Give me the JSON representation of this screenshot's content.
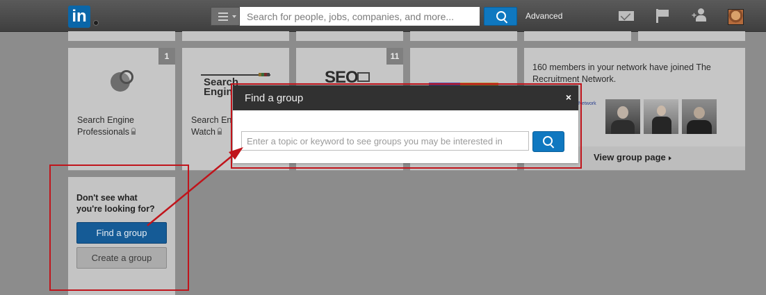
{
  "topnav": {
    "logo_text": "in",
    "search_placeholder": "Search for people, jobs, companies, and more...",
    "advanced_label": "Advanced",
    "icons": [
      "menu-icon",
      "search-icon",
      "mail-icon",
      "flag-icon",
      "add-connection-icon",
      "profile-avatar"
    ]
  },
  "cards": [
    {
      "badge": "1",
      "title_line1": "Search Engine",
      "title_line2": "Professionals",
      "logo_icon": "globe-magnifier-icon"
    },
    {
      "badge": "",
      "logo_text_line1": "Search",
      "logo_text_line2": "Engine",
      "title_line1": "Search En",
      "title_line2": "Watch"
    },
    {
      "badge": "11",
      "logo_text": "SEO"
    },
    {
      "badge": ""
    }
  ],
  "promo": {
    "text": "160 members in your network have joined The Recruitment Network.",
    "view_link": "View group page",
    "logo_snippet": "Network"
  },
  "side_panel": {
    "question_line1": "Don't see what",
    "question_line2": "you're looking for?",
    "find_button": "Find a group",
    "create_button": "Create a group"
  },
  "modal": {
    "title": "Find a group",
    "close_label": "×",
    "input_placeholder": "Enter a topic or keyword to see groups you may be interested in"
  },
  "colors": {
    "linkedin_blue": "#0a66a8",
    "primary_button": "#0f78c0",
    "annotation_red": "#c0141b",
    "modal_header": "#313131"
  }
}
